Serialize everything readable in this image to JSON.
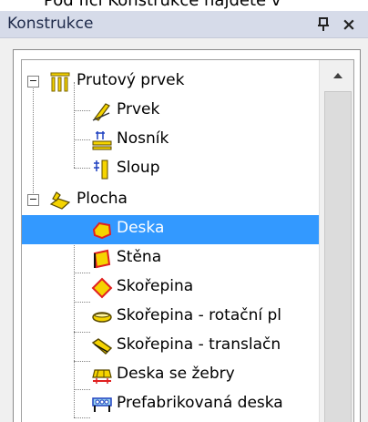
{
  "caption": "Pod fičí Konstrukce najdete v",
  "panel": {
    "title": "Konstrukce",
    "pin_icon": "pin-icon",
    "close_symbol": "×"
  },
  "tree": {
    "member_group": {
      "label": "Prutový prvek",
      "expander": "−",
      "children": [
        {
          "label": "Prvek",
          "icon": "member-icon"
        },
        {
          "label": "Nosník",
          "icon": "beam-icon"
        },
        {
          "label": "Sloup",
          "icon": "column-icon"
        }
      ]
    },
    "surface_group": {
      "label": "Plocha",
      "expander": "−",
      "children": [
        {
          "label": "Deska",
          "icon": "plate-icon",
          "selected": true
        },
        {
          "label": "Stěna",
          "icon": "wall-icon"
        },
        {
          "label": "Skořepina",
          "icon": "shell-icon"
        },
        {
          "label": "Skořepina - rotační pl",
          "icon": "rotational-shell-icon"
        },
        {
          "label": "Skořepina - translačn",
          "icon": "translational-shell-icon"
        },
        {
          "label": "Deska se žebry",
          "icon": "ribbed-plate-icon"
        },
        {
          "label": "Prefabrikovaná deska",
          "icon": "precast-plate-icon"
        }
      ]
    }
  },
  "colors": {
    "selection": "#3399ff",
    "title_bar": "#d6dbe9",
    "icon_yellow": "#f5d400",
    "icon_red": "#e02020"
  }
}
